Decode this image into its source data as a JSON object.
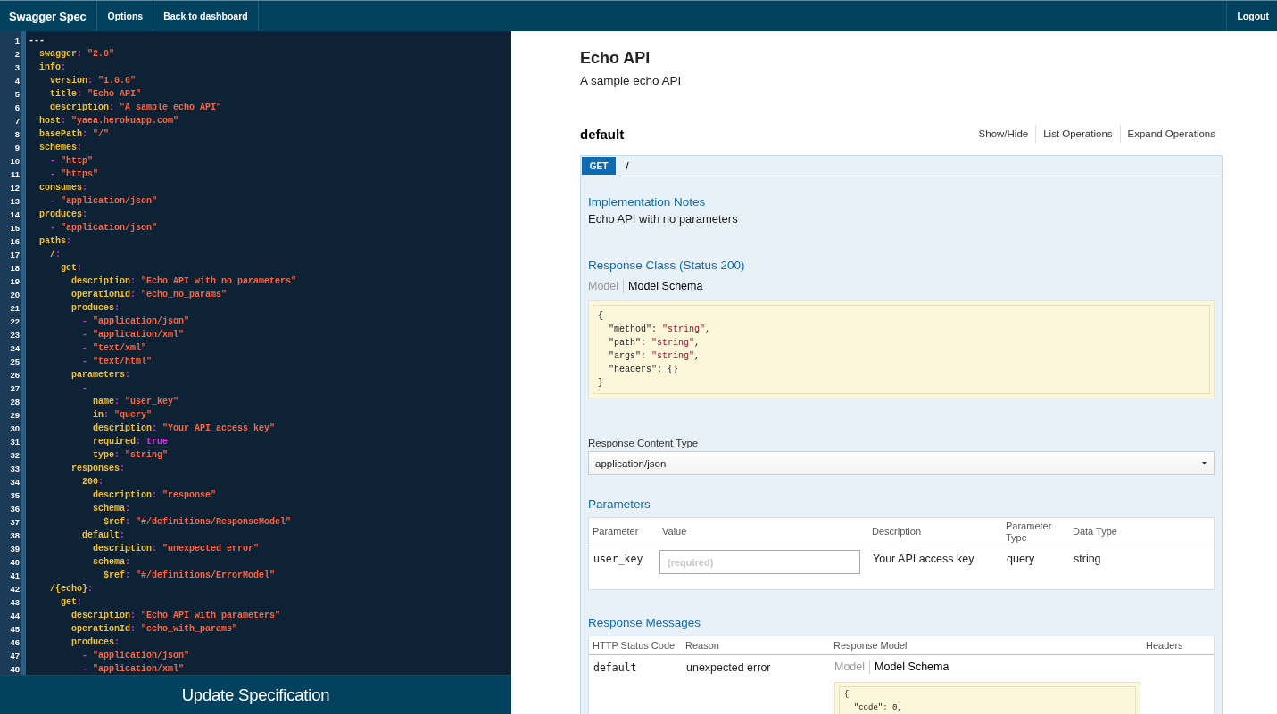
{
  "navbar": {
    "brand": "Swagger Spec",
    "links": [
      "Options",
      "Back to dashboard"
    ],
    "logout": "Logout"
  },
  "editor": {
    "lines": [
      {
        "number": "1",
        "tokens": [
          {
            "kind": "plain",
            "text": "---"
          }
        ]
      },
      {
        "number": "2",
        "tokens": [
          {
            "kind": "key",
            "text": "  swagger"
          },
          {
            "kind": "colon",
            "text": ":"
          },
          {
            "kind": "string",
            "text": " \"2.0\""
          }
        ]
      },
      {
        "number": "3",
        "tokens": [
          {
            "kind": "key",
            "text": "  info"
          },
          {
            "kind": "colon",
            "text": ":"
          }
        ]
      },
      {
        "number": "4",
        "tokens": [
          {
            "kind": "key",
            "text": "    version"
          },
          {
            "kind": "colon",
            "text": ":"
          },
          {
            "kind": "string",
            "text": " \"1.0.0\""
          }
        ]
      },
      {
        "number": "5",
        "tokens": [
          {
            "kind": "key",
            "text": "    title"
          },
          {
            "kind": "colon",
            "text": ":"
          },
          {
            "kind": "string",
            "text": " \"Echo API\""
          }
        ]
      },
      {
        "number": "6",
        "tokens": [
          {
            "kind": "key",
            "text": "    description"
          },
          {
            "kind": "colon",
            "text": ":"
          },
          {
            "kind": "string",
            "text": " \"A sample echo API\""
          }
        ]
      },
      {
        "number": "7",
        "tokens": [
          {
            "kind": "key",
            "text": "  host"
          },
          {
            "kind": "colon",
            "text": ":"
          },
          {
            "kind": "string",
            "text": " \"yaea.herokuapp.com\""
          }
        ]
      },
      {
        "number": "8",
        "tokens": [
          {
            "kind": "key",
            "text": "  basePath"
          },
          {
            "kind": "colon",
            "text": ":"
          },
          {
            "kind": "string",
            "text": " \"/\""
          }
        ]
      },
      {
        "number": "9",
        "tokens": [
          {
            "kind": "key",
            "text": "  schemes"
          },
          {
            "kind": "colon",
            "text": ":"
          }
        ]
      },
      {
        "number": "10",
        "tokens": [
          {
            "kind": "dash",
            "text": "    -"
          },
          {
            "kind": "string",
            "text": " \"http\""
          }
        ]
      },
      {
        "number": "11",
        "tokens": [
          {
            "kind": "dash",
            "text": "    -"
          },
          {
            "kind": "string",
            "text": " \"https\""
          }
        ]
      },
      {
        "number": "12",
        "tokens": [
          {
            "kind": "key",
            "text": "  consumes"
          },
          {
            "kind": "colon",
            "text": ":"
          }
        ]
      },
      {
        "number": "13",
        "tokens": [
          {
            "kind": "dash",
            "text": "    -"
          },
          {
            "kind": "string",
            "text": " \"application/json\""
          }
        ]
      },
      {
        "number": "14",
        "tokens": [
          {
            "kind": "key",
            "text": "  produces"
          },
          {
            "kind": "colon",
            "text": ":"
          }
        ]
      },
      {
        "number": "15",
        "tokens": [
          {
            "kind": "dash",
            "text": "    -"
          },
          {
            "kind": "string",
            "text": " \"application/json\""
          }
        ]
      },
      {
        "number": "16",
        "tokens": [
          {
            "kind": "key",
            "text": "  paths"
          },
          {
            "kind": "colon",
            "text": ":"
          }
        ]
      },
      {
        "number": "17",
        "tokens": [
          {
            "kind": "key",
            "text": "    /"
          },
          {
            "kind": "colon",
            "text": ":"
          }
        ]
      },
      {
        "number": "18",
        "tokens": [
          {
            "kind": "key",
            "text": "      get"
          },
          {
            "kind": "colon",
            "text": ":"
          }
        ]
      },
      {
        "number": "19",
        "tokens": [
          {
            "kind": "key",
            "text": "        description"
          },
          {
            "kind": "colon",
            "text": ":"
          },
          {
            "kind": "string",
            "text": " \"Echo API with no parameters\""
          }
        ]
      },
      {
        "number": "20",
        "tokens": [
          {
            "kind": "key",
            "text": "        operationId"
          },
          {
            "kind": "colon",
            "text": ":"
          },
          {
            "kind": "string",
            "text": " \"echo_no_params\""
          }
        ]
      },
      {
        "number": "21",
        "tokens": [
          {
            "kind": "key",
            "text": "        produces"
          },
          {
            "kind": "colon",
            "text": ":"
          }
        ]
      },
      {
        "number": "22",
        "tokens": [
          {
            "kind": "dash",
            "text": "          -"
          },
          {
            "kind": "string",
            "text": " \"application/json\""
          }
        ]
      },
      {
        "number": "23",
        "tokens": [
          {
            "kind": "dash",
            "text": "          -"
          },
          {
            "kind": "string",
            "text": " \"application/xml\""
          }
        ]
      },
      {
        "number": "24",
        "tokens": [
          {
            "kind": "dash",
            "text": "          -"
          },
          {
            "kind": "string",
            "text": " \"text/xml\""
          }
        ]
      },
      {
        "number": "25",
        "tokens": [
          {
            "kind": "dash",
            "text": "          -"
          },
          {
            "kind": "string",
            "text": " \"text/html\""
          }
        ]
      },
      {
        "number": "26",
        "tokens": [
          {
            "kind": "key",
            "text": "        parameters"
          },
          {
            "kind": "colon",
            "text": ":"
          }
        ]
      },
      {
        "number": "27",
        "tokens": [
          {
            "kind": "dash",
            "text": "          -"
          }
        ]
      },
      {
        "number": "28",
        "tokens": [
          {
            "kind": "key",
            "text": "            name"
          },
          {
            "kind": "colon",
            "text": ":"
          },
          {
            "kind": "string",
            "text": " \"user_key\""
          }
        ]
      },
      {
        "number": "29",
        "tokens": [
          {
            "kind": "key",
            "text": "            in"
          },
          {
            "kind": "colon",
            "text": ":"
          },
          {
            "kind": "string",
            "text": " \"query\""
          }
        ]
      },
      {
        "number": "30",
        "tokens": [
          {
            "kind": "key",
            "text": "            description"
          },
          {
            "kind": "colon",
            "text": ":"
          },
          {
            "kind": "string",
            "text": " \"Your API access key\""
          }
        ]
      },
      {
        "number": "31",
        "tokens": [
          {
            "kind": "key",
            "text": "            required"
          },
          {
            "kind": "colon",
            "text": ":"
          },
          {
            "kind": "bool",
            "text": " true"
          }
        ]
      },
      {
        "number": "32",
        "tokens": [
          {
            "kind": "key",
            "text": "            type"
          },
          {
            "kind": "colon",
            "text": ":"
          },
          {
            "kind": "string",
            "text": " \"string\""
          }
        ]
      },
      {
        "number": "33",
        "tokens": [
          {
            "kind": "key",
            "text": "        responses"
          },
          {
            "kind": "colon",
            "text": ":"
          }
        ]
      },
      {
        "number": "34",
        "tokens": [
          {
            "kind": "key",
            "text": "          200"
          },
          {
            "kind": "colon",
            "text": ":"
          }
        ]
      },
      {
        "number": "35",
        "tokens": [
          {
            "kind": "key",
            "text": "            description"
          },
          {
            "kind": "colon",
            "text": ":"
          },
          {
            "kind": "string",
            "text": " \"response\""
          }
        ]
      },
      {
        "number": "36",
        "tokens": [
          {
            "kind": "key",
            "text": "            schema"
          },
          {
            "kind": "colon",
            "text": ":"
          }
        ]
      },
      {
        "number": "37",
        "tokens": [
          {
            "kind": "key",
            "text": "              $ref"
          },
          {
            "kind": "colon",
            "text": ":"
          },
          {
            "kind": "string",
            "text": " \"#/definitions/ResponseModel\""
          }
        ]
      },
      {
        "number": "38",
        "tokens": [
          {
            "kind": "key",
            "text": "          default"
          },
          {
            "kind": "colon",
            "text": ":"
          }
        ]
      },
      {
        "number": "39",
        "tokens": [
          {
            "kind": "key",
            "text": "            description"
          },
          {
            "kind": "colon",
            "text": ":"
          },
          {
            "kind": "string",
            "text": " \"unexpected error\""
          }
        ]
      },
      {
        "number": "40",
        "tokens": [
          {
            "kind": "key",
            "text": "            schema"
          },
          {
            "kind": "colon",
            "text": ":"
          }
        ]
      },
      {
        "number": "41",
        "tokens": [
          {
            "kind": "key",
            "text": "              $ref"
          },
          {
            "kind": "colon",
            "text": ":"
          },
          {
            "kind": "string",
            "text": " \"#/definitions/ErrorModel\""
          }
        ]
      },
      {
        "number": "42",
        "tokens": [
          {
            "kind": "key",
            "text": "    /{echo}"
          },
          {
            "kind": "colon",
            "text": ":"
          }
        ]
      },
      {
        "number": "43",
        "tokens": [
          {
            "kind": "key",
            "text": "      get"
          },
          {
            "kind": "colon",
            "text": ":"
          }
        ]
      },
      {
        "number": "44",
        "tokens": [
          {
            "kind": "key",
            "text": "        description"
          },
          {
            "kind": "colon",
            "text": ":"
          },
          {
            "kind": "string",
            "text": " \"Echo API with parameters\""
          }
        ]
      },
      {
        "number": "45",
        "tokens": [
          {
            "kind": "key",
            "text": "        operationId"
          },
          {
            "kind": "colon",
            "text": ":"
          },
          {
            "kind": "string",
            "text": " \"echo_with_params\""
          }
        ]
      },
      {
        "number": "46",
        "tokens": [
          {
            "kind": "key",
            "text": "        produces"
          },
          {
            "kind": "colon",
            "text": ":"
          }
        ]
      },
      {
        "number": "47",
        "tokens": [
          {
            "kind": "dash",
            "text": "          -"
          },
          {
            "kind": "string",
            "text": " \"application/json\""
          }
        ]
      },
      {
        "number": "48",
        "tokens": [
          {
            "kind": "dash",
            "text": "          -"
          },
          {
            "kind": "string",
            "text": " \"application/xml\""
          }
        ]
      }
    ]
  },
  "update_button": "Update Specification",
  "api": {
    "title": "Echo API",
    "description": "A sample echo API"
  },
  "resource": {
    "name": "default",
    "actions": [
      "Show/Hide",
      "List Operations",
      "Expand Operations"
    ],
    "operation": {
      "method": "GET",
      "path": "/",
      "notes_heading": "Implementation Notes",
      "notes": "Echo API with no parameters",
      "response_class": {
        "heading": "Response Class (Status 200)",
        "tabs": [
          {
            "label": "Model",
            "selected": false
          },
          {
            "label": "Model Schema",
            "selected": true
          }
        ],
        "schema": [
          [
            {
              "kind": "plain",
              "text": "{"
            }
          ],
          [
            {
              "kind": "plain",
              "text": "  \"method\": "
            },
            {
              "kind": "string",
              "text": "\"string\""
            },
            {
              "kind": "plain",
              "text": ","
            }
          ],
          [
            {
              "kind": "plain",
              "text": "  \"path\": "
            },
            {
              "kind": "string",
              "text": "\"string\""
            },
            {
              "kind": "plain",
              "text": ","
            }
          ],
          [
            {
              "kind": "plain",
              "text": "  \"args\": "
            },
            {
              "kind": "string",
              "text": "\"string\""
            },
            {
              "kind": "plain",
              "text": ","
            }
          ],
          [
            {
              "kind": "plain",
              "text": "  \"headers\": {}"
            }
          ],
          [
            {
              "kind": "plain",
              "text": "}"
            }
          ]
        ]
      },
      "content_type": {
        "label": "Response Content Type",
        "value": "application/json"
      },
      "parameters": {
        "heading": "Parameters",
        "columns": [
          "Parameter",
          "Value",
          "Description",
          "Parameter Type",
          "Data Type"
        ],
        "rows": [
          {
            "name": "user_key",
            "placeholder": "(required)",
            "description": "Your API access key",
            "type": "query",
            "data_type": "string"
          }
        ]
      },
      "response_messages": {
        "heading": "Response Messages",
        "columns": [
          "HTTP Status Code",
          "Reason",
          "Response Model",
          "Headers"
        ],
        "rows": [
          {
            "code": "default",
            "reason": "unexpected error",
            "tabs": [
              {
                "label": "Model",
                "selected": false
              },
              {
                "label": "Model Schema",
                "selected": true
              }
            ],
            "schema": [
              [
                {
                  "kind": "plain",
                  "text": "{"
                }
              ],
              [
                {
                  "kind": "plain",
                  "text": "  \"code\": 0,"
                }
              ]
            ]
          }
        ]
      }
    }
  }
}
